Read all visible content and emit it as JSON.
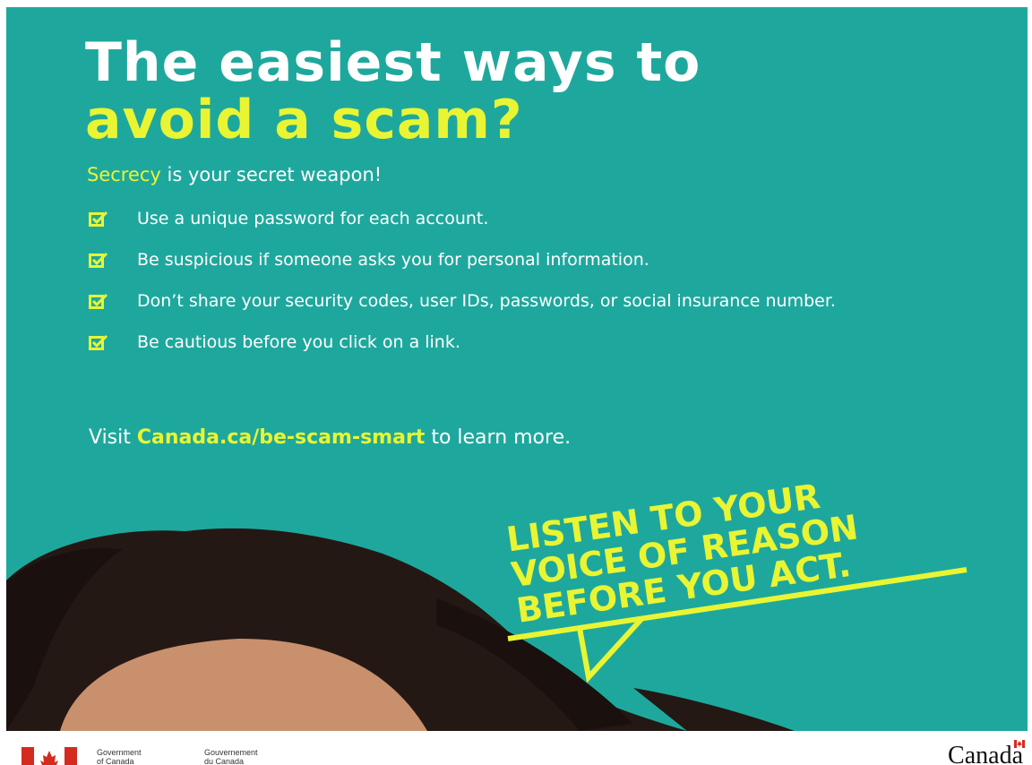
{
  "poster": {
    "headline_line1": "The easiest ways to",
    "headline_line2": "avoid a scam?",
    "lead_highlight": "Secrecy",
    "lead_rest": " is your secret weapon!",
    "tips": [
      "Use a unique password for each account.",
      "Be suspicious if someone asks you for personal information.",
      "Don’t share your security codes, user IDs, passwords, or social insurance number.",
      "Be cautious before you click on a link."
    ],
    "visit_prefix": "Visit ",
    "visit_link": "Canada.ca/be-scam-smart",
    "visit_suffix": " to learn more.",
    "slogan": [
      "LISTEN TO YOUR",
      "VOICE OF REASON",
      "BEFORE YOU ACT."
    ],
    "icons": {
      "tip_bullet": "checkbox-icon",
      "speech": "speech-bubble-icon"
    },
    "colors": {
      "background": "#1ea89d",
      "accent": "#e9f533",
      "text": "#ffffff"
    }
  },
  "footer": {
    "gov_en_1": "Government",
    "gov_en_2": "of Canada",
    "gov_fr_1": "Gouvernement",
    "gov_fr_2": "du Canada",
    "wordmark": "Canada",
    "icons": {
      "flag": "canada-flag-icon"
    }
  }
}
